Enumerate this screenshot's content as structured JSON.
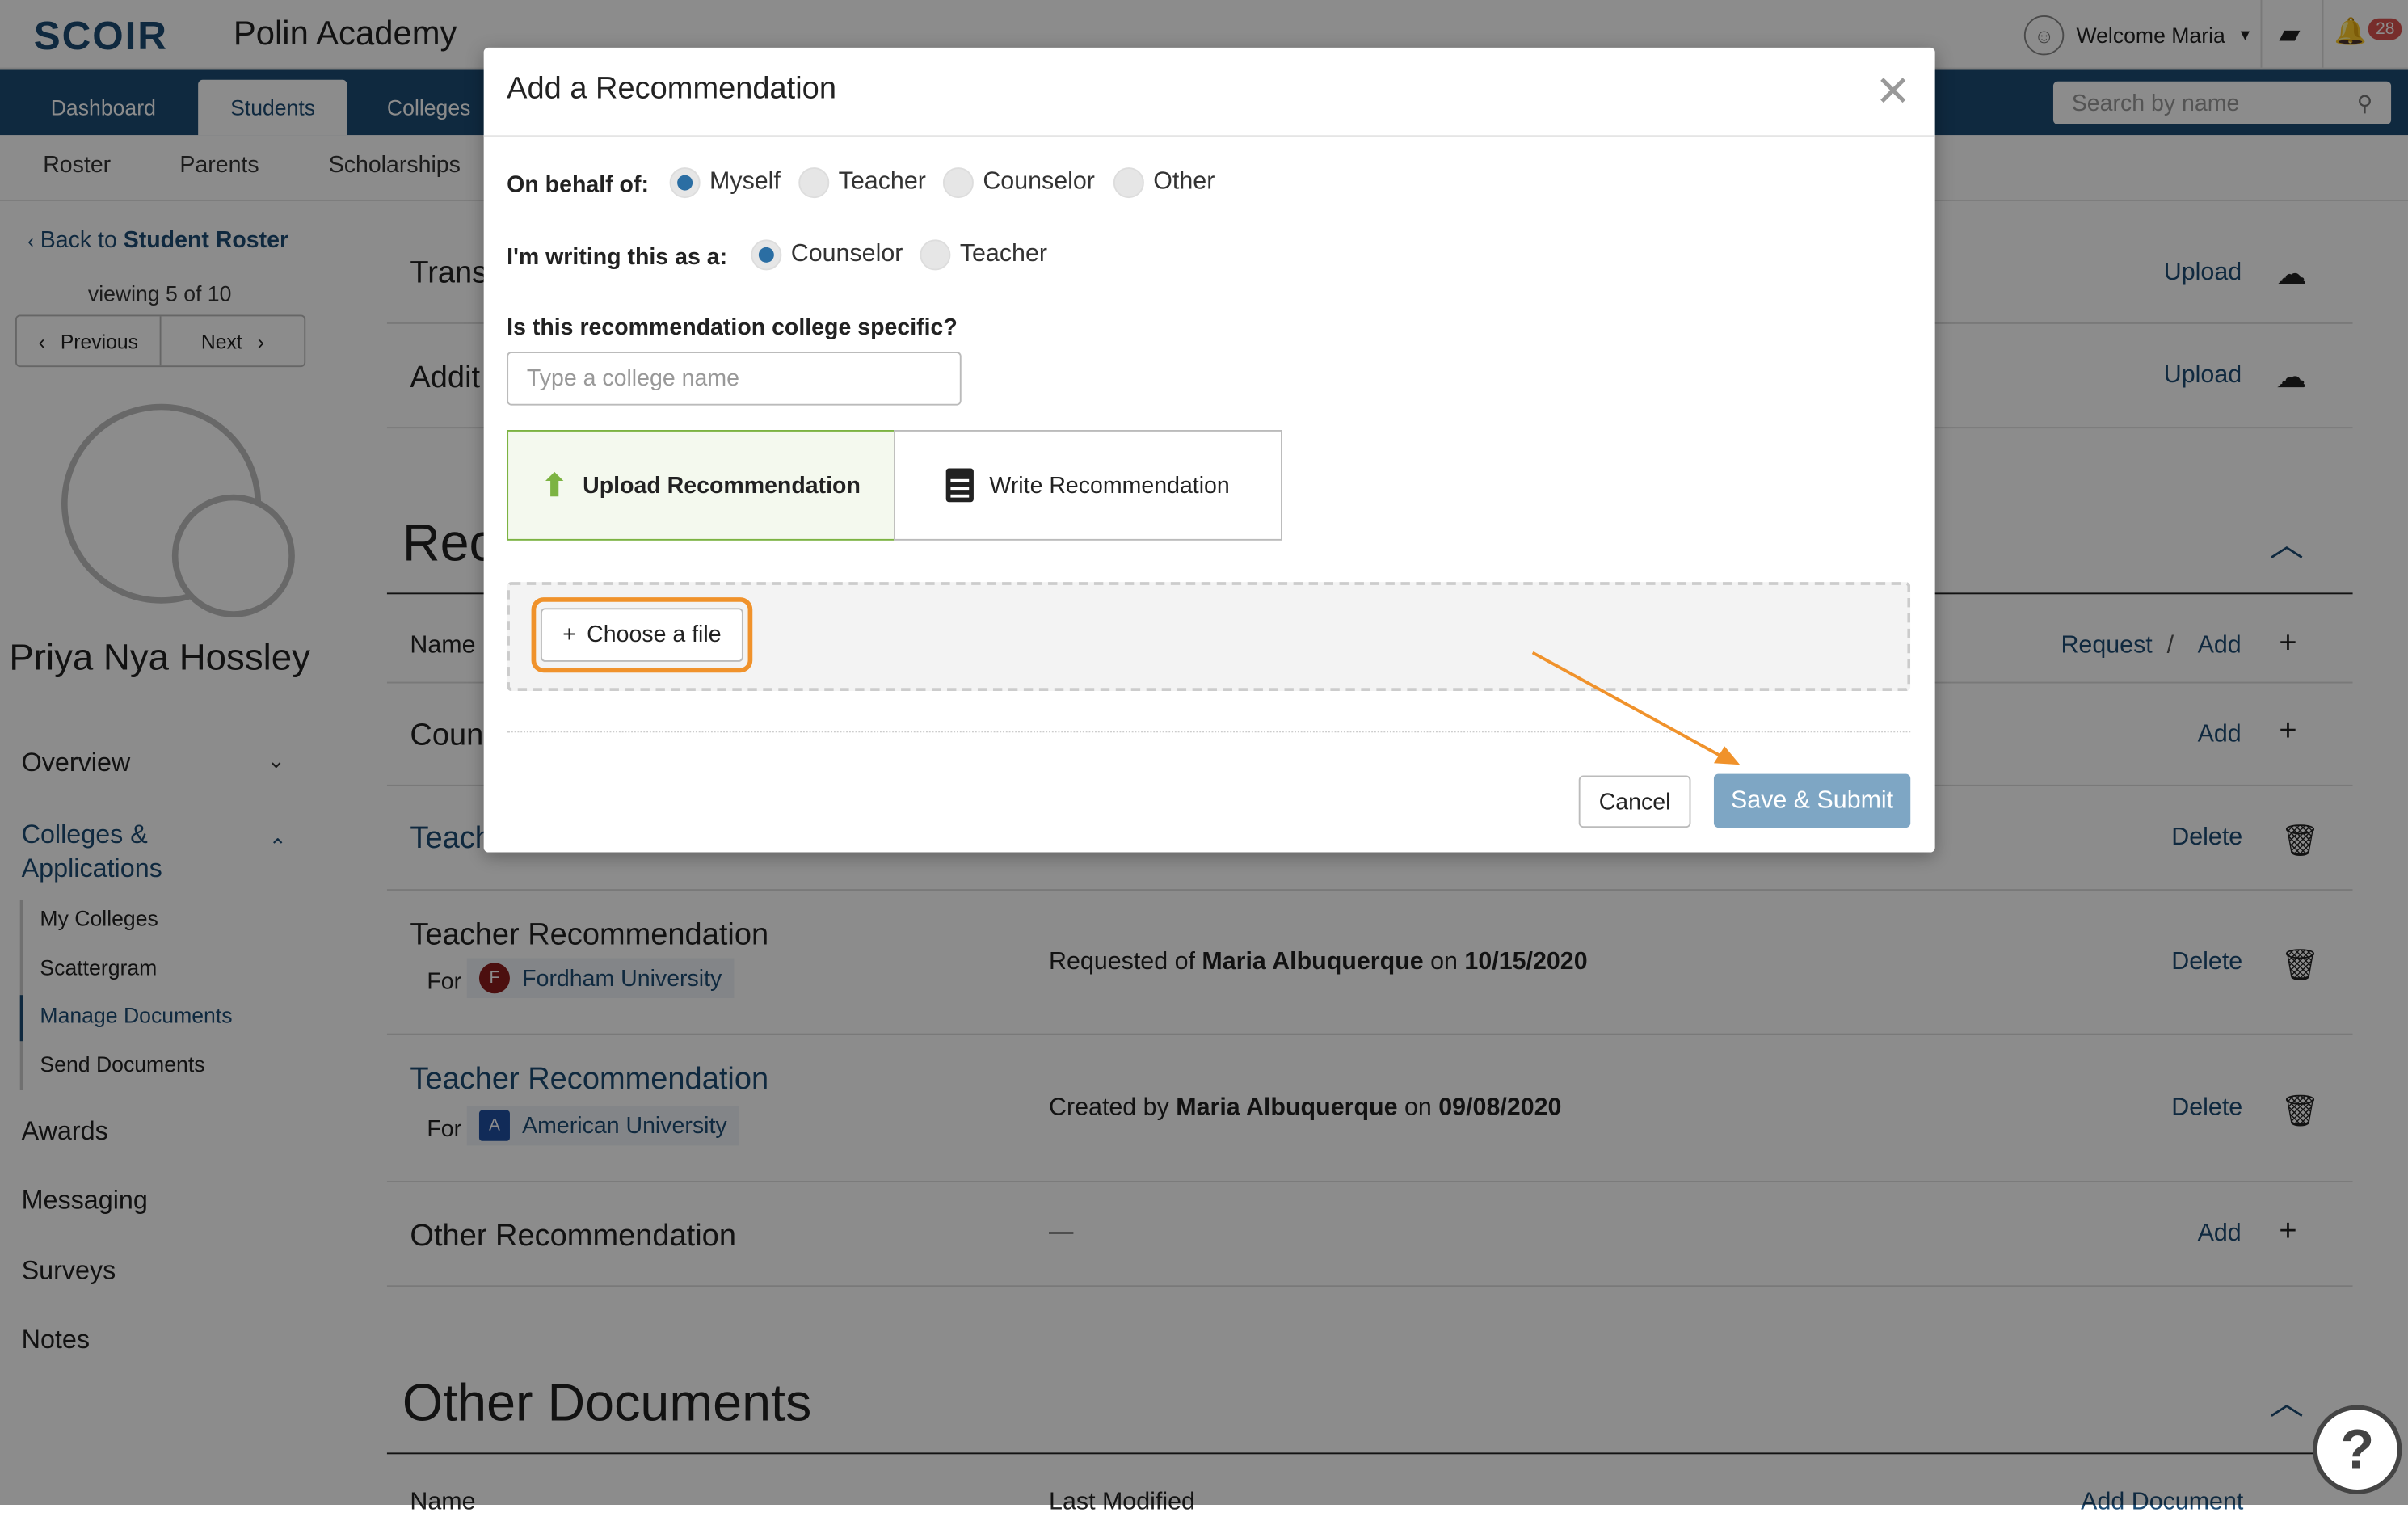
{
  "header": {
    "logo": "SCOIR",
    "school_name": "Polin Academy",
    "welcome": "Welcome Maria",
    "notification_count": "28"
  },
  "nav": {
    "tabs": [
      "Dashboard",
      "Students",
      "Colleges"
    ],
    "active": "Students",
    "search_placeholder": "Search by name"
  },
  "subnav": {
    "items": [
      "Roster",
      "Parents",
      "Scholarships"
    ]
  },
  "sidebar": {
    "back_prefix": "Back to",
    "back_target": "Student Roster",
    "viewing": "viewing 5 of 10",
    "prev": "Previous",
    "next": "Next",
    "student_name": "Priya Nya Hossley",
    "overview": "Overview",
    "colleges_apps": "Colleges & Applications",
    "sub_items": [
      "My Colleges",
      "Scattergram",
      "Manage Documents",
      "Send Documents"
    ],
    "links": [
      "Awards",
      "Messaging",
      "Surveys",
      "Notes"
    ]
  },
  "main": {
    "transcripts_label": "Trans",
    "additional_label": "Addit",
    "upload": "Upload",
    "rec_section": "Rec",
    "name_col": "Name",
    "request": "Request",
    "slash": "/",
    "add": "Add",
    "counselor_row": "Coun",
    "teacher_row_partial": "Teach",
    "delete": "Delete",
    "rows": [
      {
        "title": "Teacher Recommendation",
        "for": "For",
        "college": "Fordham University",
        "seal": "F",
        "prefix": "Requested of",
        "person": "Maria Albuquerque",
        "on": "on",
        "date": "10/15/2020"
      },
      {
        "title": "Teacher Recommendation",
        "for": "For",
        "college": "American University",
        "seal": "A",
        "prefix": "Created by",
        "person": "Maria Albuquerque",
        "on": "on",
        "date": "09/08/2020"
      }
    ],
    "other_rec": "Other Recommendation",
    "dash": "—",
    "other_docs": "Other Documents",
    "other_docs_name": "Name",
    "other_docs_modified": "Last Modified",
    "add_document": "Add Document"
  },
  "modal": {
    "title": "Add a Recommendation",
    "behalf_label": "On behalf of:",
    "behalf_options": [
      "Myself",
      "Teacher",
      "Counselor",
      "Other"
    ],
    "behalf_selected": 0,
    "writing_label": "I'm writing this as a:",
    "writing_options": [
      "Counselor",
      "Teacher"
    ],
    "writing_selected": 0,
    "college_specific_label": "Is this recommendation college specific?",
    "college_placeholder": "Type a college name",
    "upload_tab": "Upload Recommendation",
    "write_tab": "Write Recommendation",
    "choose_file": "Choose a file",
    "cancel": "Cancel",
    "save": "Save & Submit"
  },
  "colors": {
    "brand": "#1d4b73",
    "accent_green": "#7cb342",
    "annotation": "#f0922b",
    "save_button": "#7ea6c4"
  }
}
